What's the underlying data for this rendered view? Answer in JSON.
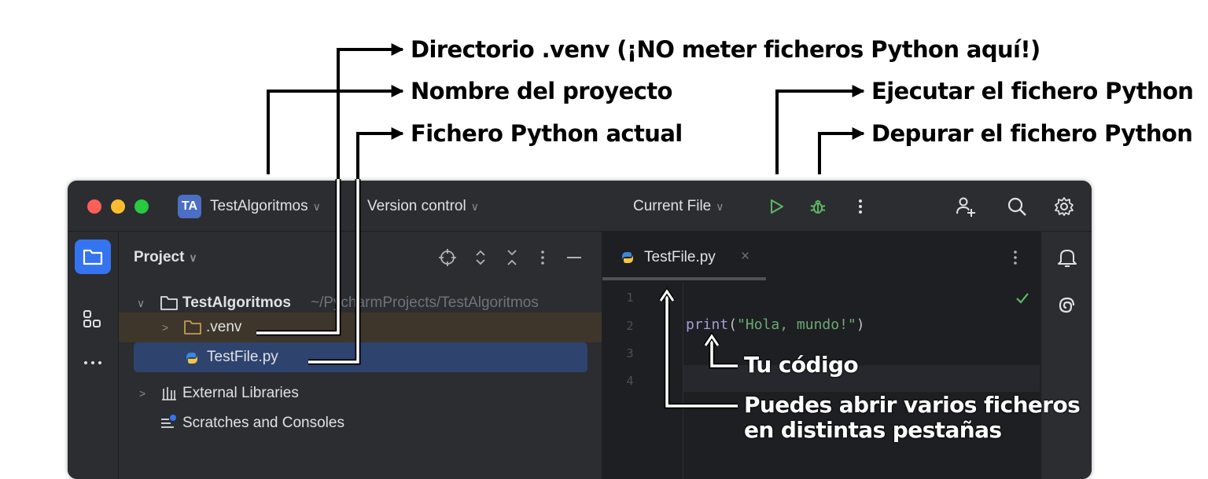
{
  "annotations": {
    "venv_dir": "Directorio .venv (¡NO meter ficheros Python aquí!)",
    "project_name": "Nombre del proyecto",
    "current_file": "Fichero Python actual",
    "run_file": "Ejecutar el fichero Python",
    "debug_file": "Depurar el fichero Python",
    "your_code": "Tu código",
    "tabs_line1": "Puedes abrir varios ficheros",
    "tabs_line2": "en distintas pestañas"
  },
  "titlebar": {
    "avatar_initials": "TA",
    "project_name": "TestAlgoritmos",
    "version_control": "Version control",
    "run_config": "Current File"
  },
  "project_panel": {
    "title": "Project",
    "tree": {
      "root_name": "TestAlgoritmos",
      "root_path": "~/PycharmProjects/TestAlgoritmos",
      "venv": ".venv",
      "file": "TestFile.py",
      "external_libraries": "External Libraries",
      "scratches": "Scratches and Consoles"
    }
  },
  "editor": {
    "tab_name": "TestFile.py",
    "line_numbers": [
      "1",
      "2",
      "3",
      "4"
    ],
    "code_fn": "print",
    "code_open": "(",
    "code_string": "\"Hola, mundo!\"",
    "code_close": ")"
  },
  "colors": {
    "window_bg": "#1e1f22",
    "panel_bg": "#2b2d30",
    "selected_row": "#2e436e",
    "accent": "#3574f0",
    "run_green": "#5fb865",
    "string_green": "#6aab73",
    "function_purple": "#a39dd8"
  }
}
